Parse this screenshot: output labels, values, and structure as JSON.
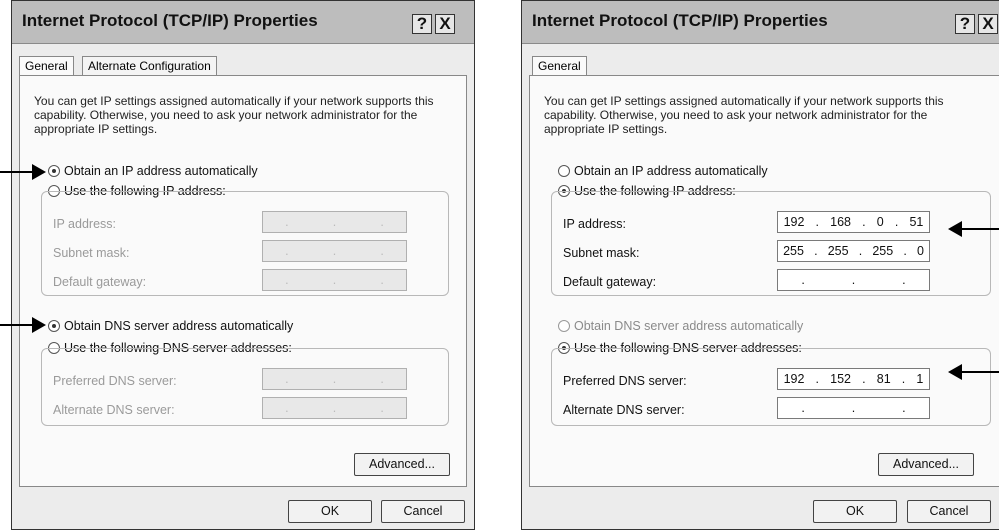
{
  "left_dialog": {
    "title": "Internet Protocol (TCP/IP) Properties",
    "help_glyph": "?",
    "close_glyph": "X",
    "tabs": [
      "General",
      "Alternate Configuration"
    ],
    "description": "You can get IP settings assigned automatically if your network supports this capability. Otherwise, you need to ask your network administrator for the appropriate IP settings.",
    "radio_obtain_ip": "Obtain an IP address automatically",
    "radio_use_ip": "Use the following IP address:",
    "label_ip": "IP address:",
    "label_subnet": "Subnet mask:",
    "label_gateway": "Default gateway:",
    "radio_obtain_dns": "Obtain DNS server address automatically",
    "radio_use_dns": "Use the following DNS server addresses:",
    "label_pref_dns": "Preferred DNS server:",
    "label_alt_dns": "Alternate DNS server:",
    "advanced_label": "Advanced...",
    "ok_label": "OK",
    "cancel_label": "Cancel"
  },
  "right_dialog": {
    "title": "Internet Protocol (TCP/IP) Properties",
    "help_glyph": "?",
    "close_glyph": "X",
    "tabs": [
      "General"
    ],
    "description": "You can get IP settings assigned automatically if your network supports this capability. Otherwise, you need to ask your network administrator for the appropriate IP settings.",
    "radio_obtain_ip": "Obtain an IP address automatically",
    "radio_use_ip": "Use the following IP address:",
    "label_ip": "IP address:",
    "label_subnet": "Subnet mask:",
    "label_gateway": "Default gateway:",
    "ip_address": [
      "192",
      "168",
      "0",
      "51"
    ],
    "subnet_mask": [
      "255",
      "255",
      "255",
      "0"
    ],
    "radio_obtain_dns": "Obtain DNS server address automatically",
    "radio_use_dns": "Use the following DNS server addresses:",
    "label_pref_dns": "Preferred DNS server:",
    "label_alt_dns": "Alternate DNS server:",
    "preferred_dns": [
      "192",
      "152",
      "81",
      "1"
    ],
    "advanced_label": "Advanced...",
    "ok_label": "OK",
    "cancel_label": "Cancel"
  }
}
